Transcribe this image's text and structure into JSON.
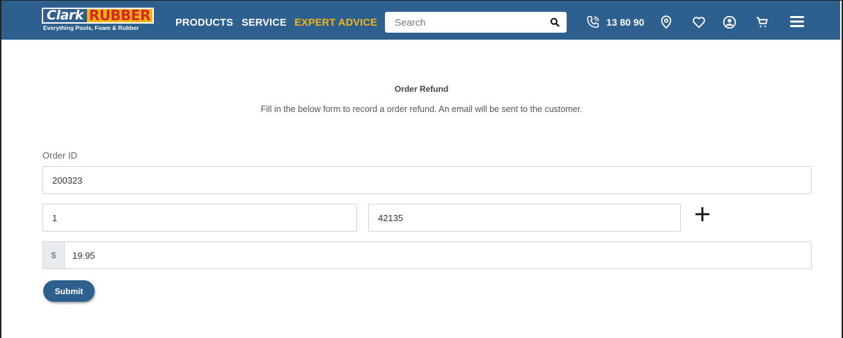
{
  "brand": {
    "logo_part1": "Clark",
    "logo_part2": "RUBBER",
    "tagline": "Everything Pools, Foam & Rubber",
    "colors": {
      "header_bg": "#2d5f8f",
      "accent_yellow": "#f5b416",
      "logo_red": "#d7261e"
    }
  },
  "nav": {
    "products": "PRODUCTS",
    "service": "SERVICE",
    "expert_advice": "EXPERT ADVICE"
  },
  "search": {
    "placeholder": "Search",
    "icon": "search-icon"
  },
  "header_icons": {
    "phone_icon": "phone-icon",
    "phone_number": "13 80 90",
    "location": "location-pin-icon",
    "wishlist": "heart-icon",
    "account": "user-circle-icon",
    "cart": "cart-icon",
    "menu": "hamburger-menu-icon"
  },
  "form": {
    "title": "Order Refund",
    "subtitle": "Fill in the below form to record a order refund. An email will be sent to the customer.",
    "order_id_label": "Order ID",
    "order_id_value": "200323",
    "quantity_value": "1",
    "product_value": "42135",
    "add_icon": "plus-icon",
    "currency_prefix": "$",
    "amount_value": "19.95",
    "submit_label": "Submit"
  }
}
